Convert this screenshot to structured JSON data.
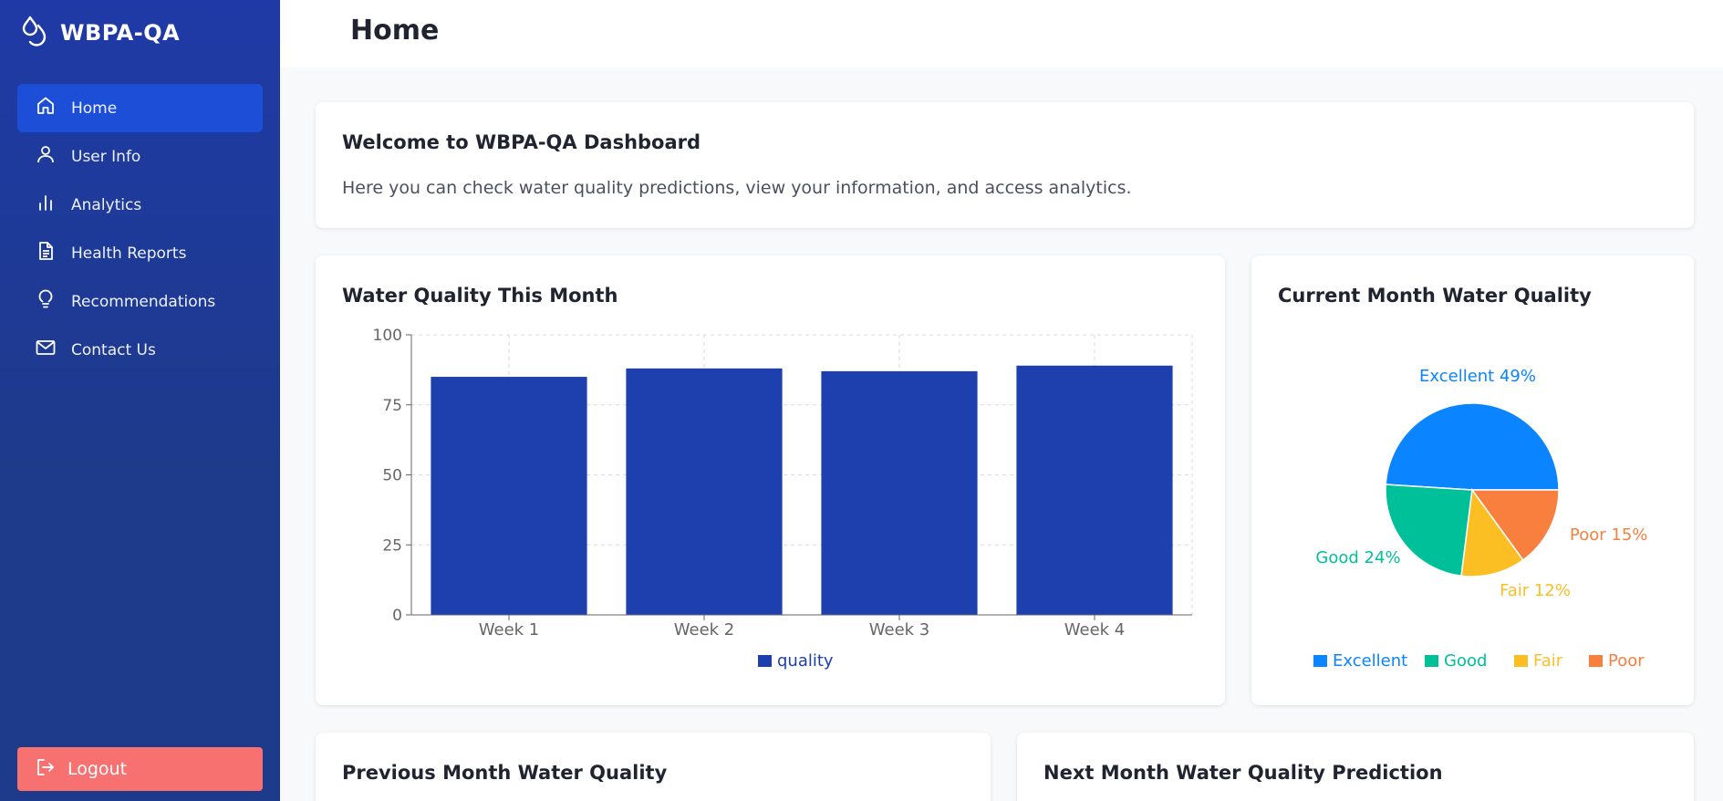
{
  "brand": {
    "name": "WBPA-QA",
    "icon": "water-drops-icon"
  },
  "nav": [
    {
      "label": "Home",
      "icon": "home-icon",
      "active": true
    },
    {
      "label": "User Info",
      "icon": "user-icon",
      "active": false
    },
    {
      "label": "Analytics",
      "icon": "bar-chart-icon",
      "active": false
    },
    {
      "label": "Health Reports",
      "icon": "document-icon",
      "active": false
    },
    {
      "label": "Recommendations",
      "icon": "lightbulb-icon",
      "active": false
    },
    {
      "label": "Contact Us",
      "icon": "mail-icon",
      "active": false
    }
  ],
  "logout": {
    "label": "Logout",
    "icon": "logout-icon"
  },
  "header": {
    "title": "Home"
  },
  "welcome": {
    "title": "Welcome to WBPA-QA Dashboard",
    "text": "Here you can check water quality predictions, view your information, and access analytics."
  },
  "cards": {
    "bar_title": "Water Quality This Month",
    "pie_title": "Current Month Water Quality",
    "prev_title": "Previous Month Water Quality",
    "next_title": "Next Month Water Quality Prediction"
  },
  "colors": {
    "bar": "#1e40af",
    "excellent": "#0a84ff",
    "good": "#00c09a",
    "fair": "#fbbf24",
    "poor": "#f97f3e"
  },
  "chart_data": [
    {
      "type": "bar",
      "title": "Water Quality This Month",
      "categories": [
        "Week 1",
        "Week 2",
        "Week 3",
        "Week 4"
      ],
      "series": [
        {
          "name": "quality",
          "values": [
            85,
            88,
            87,
            89
          ]
        }
      ],
      "ylim": [
        0,
        100
      ],
      "yticks": [
        0,
        25,
        50,
        75,
        100
      ],
      "grid": true,
      "legend": "bottom"
    },
    {
      "type": "pie",
      "title": "Current Month Water Quality",
      "slices": [
        {
          "label": "Excellent",
          "value": 49,
          "text": "Excellent 49%"
        },
        {
          "label": "Good",
          "value": 24,
          "text": "Good 24%"
        },
        {
          "label": "Fair",
          "value": 12,
          "text": "Fair 12%"
        },
        {
          "label": "Poor",
          "value": 15,
          "text": "Poor 15%"
        }
      ],
      "legend": "bottom"
    }
  ]
}
